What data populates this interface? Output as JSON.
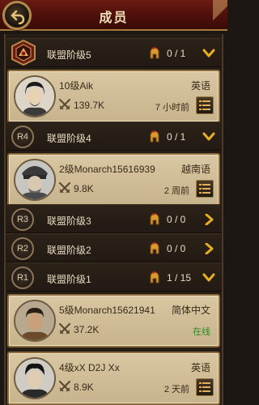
{
  "header": {
    "title": "成员"
  },
  "ranks": [
    {
      "badge": "",
      "label": "联盟阶级5",
      "count": "0 / 1",
      "expanded": true
    },
    {
      "badge": "R4",
      "label": "联盟阶级4",
      "count": "0 / 1",
      "expanded": true
    },
    {
      "badge": "R3",
      "label": "联盟阶级3",
      "count": "0 / 0",
      "expanded": false
    },
    {
      "badge": "R2",
      "label": "联盟阶级2",
      "count": "0 / 0",
      "expanded": false
    },
    {
      "badge": "R1",
      "label": "联盟阶级1",
      "count": "1 / 15",
      "expanded": true
    }
  ],
  "members": [
    {
      "name": "10级Aik",
      "language": "英语",
      "power": "139.7K",
      "last_active": "7 小时前"
    },
    {
      "name": "2级Monarch15616939",
      "language": "越南语",
      "power": "9.8K",
      "last_active": "2 周前"
    },
    {
      "name": "5级Monarch15621941",
      "language": "简体中文",
      "power": "37.2K",
      "last_active": "在线"
    },
    {
      "name": "4级xX D2J Xx",
      "language": "英语",
      "power": "8.9K",
      "last_active": "2 天前"
    }
  ],
  "colors": {
    "header_red": "#5a130d",
    "gold_border": "#a87a3c",
    "online_green": "#2b8a20",
    "chevron_gold": "#e8b020"
  },
  "icons": {
    "back": "back-arrow-icon",
    "rank_helmet": "spartan-helmet-icon",
    "expand": "chevron-down-icon",
    "collapsed": "chevron-right-icon",
    "power": "crossed-swords-icon",
    "menu": "list-menu-icon"
  }
}
